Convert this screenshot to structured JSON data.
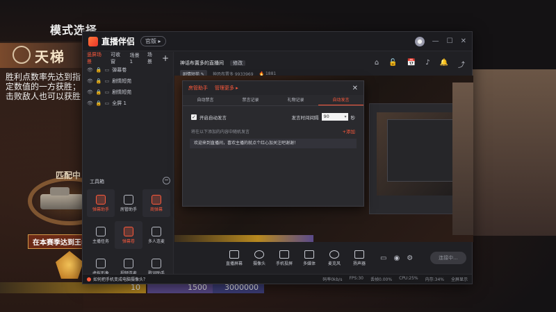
{
  "background": {
    "mode_title": "模式选择",
    "rank_name": "天梯",
    "description": "胜利点数率先达到指定数值的一方获胜；击败敌人也可以获胜",
    "match_text": "匹配中",
    "season_text": "在本赛季达到王者",
    "bar_values": [
      "10",
      "1500",
      "3000000"
    ]
  },
  "app": {
    "name": "直播伴侣",
    "version_pill": "官版 ▸",
    "window_buttons": [
      "—",
      "☐",
      "✕"
    ],
    "header_icons": [
      "⌂",
      "🔓",
      "📅",
      "♪",
      "🔔",
      "⤴"
    ]
  },
  "sidebar": {
    "tabs": [
      {
        "label": "竖屏场景",
        "active": true
      },
      {
        "label": "可收窗",
        "active": false
      },
      {
        "label": "场景1",
        "active": false
      },
      {
        "label": "场景",
        "active": false
      }
    ],
    "add_label": "+",
    "sources": [
      {
        "type": "▭",
        "label": "弹幕卷"
      },
      {
        "type": "▭",
        "label": "剧情短苑"
      },
      {
        "type": "▭",
        "label": "剧情短苑"
      },
      {
        "type": "▭",
        "label": "全屏 1"
      }
    ],
    "toolbox_title": "工具箱",
    "collapse_label": "−",
    "tools": [
      {
        "label": "弹幕助手",
        "highlight": true
      },
      {
        "label": "房管助手",
        "highlight": false
      },
      {
        "label": "商弹幕",
        "highlight": true
      },
      {
        "label": "主播任务",
        "highlight": false
      },
      {
        "label": "弹幕卷",
        "highlight": true
      },
      {
        "label": "多人连麦",
        "highlight": false
      },
      {
        "label": "虚拟形象",
        "highlight": false
      },
      {
        "label": "视频连麦",
        "highlight": false
      },
      {
        "label": "歌词助手",
        "highlight": false
      }
    ]
  },
  "header": {
    "room_title": "神话布置多的直播间",
    "edit_label": "修改",
    "category": "剧情短苑 ✎",
    "room_id": "神恐布置多 9933969",
    "hot_count": "🔥 1881"
  },
  "dialog": {
    "top_tabs": [
      "房管助手",
      "管理更多 ▸"
    ],
    "close": "✕",
    "tabs": [
      {
        "label": "自动禁言",
        "active": false
      },
      {
        "label": "禁言记录",
        "active": false
      },
      {
        "label": "礼物记录",
        "active": false
      },
      {
        "label": "自动发言",
        "active": true
      }
    ],
    "auto_send_label": "开启自动发言",
    "interval_label": "发言时间间隔",
    "interval_value": "90",
    "interval_unit": "秒",
    "hint": "将在以下添加的内容中随机发言",
    "add_label": "+添加",
    "message": "欢迎来到直播间，喜欢主播的就点个红心加关注吧谢谢！"
  },
  "bottom_bar": {
    "buttons": [
      "直播屏幕",
      "摄像头",
      "手机投屏",
      "多媒体",
      "麦克风",
      "扬声器"
    ],
    "mini_icons": [
      "▭",
      "◉",
      "⚙"
    ],
    "go_live": "连接中..."
  },
  "statusbar": {
    "tip": "如何把手机变成电脑摄像头？",
    "stats": [
      "码率0kb/s",
      "FPS:30",
      "丢帧0.00%",
      "CPU:25%",
      "内存:34%",
      "全屏显示"
    ]
  }
}
